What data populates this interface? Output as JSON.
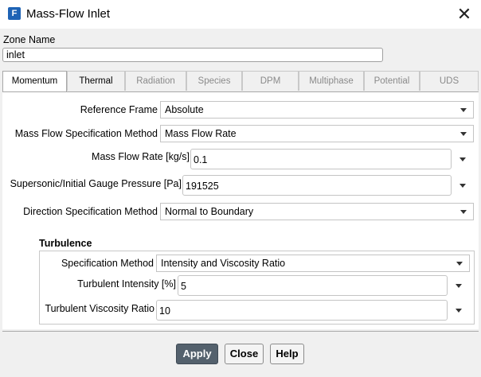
{
  "window": {
    "title": "Mass-Flow Inlet",
    "app_icon_letter": "F",
    "close_glyph": "✕"
  },
  "zone": {
    "label": "Zone Name",
    "value": "inlet"
  },
  "tabs": [
    "Momentum",
    "Thermal",
    "Radiation",
    "Species",
    "DPM",
    "Multiphase",
    "Potential",
    "UDS"
  ],
  "tabs_active": "Momentum",
  "momentum": {
    "reference_frame": {
      "label": "Reference Frame",
      "value": "Absolute"
    },
    "mass_flow_spec_method": {
      "label": "Mass Flow Specification Method",
      "value": "Mass Flow Rate"
    },
    "mass_flow_rate": {
      "label": "Mass Flow Rate [kg/s]",
      "value": "0.1"
    },
    "gauge_pressure": {
      "label": "Supersonic/Initial Gauge Pressure [Pa]",
      "value": "191525"
    },
    "direction_spec_method": {
      "label": "Direction Specification Method",
      "value": "Normal to Boundary"
    }
  },
  "turbulence": {
    "title": "Turbulence",
    "spec_method": {
      "label": "Specification Method",
      "value": "Intensity and Viscosity Ratio"
    },
    "intensity": {
      "label": "Turbulent Intensity [%]",
      "value": "5"
    },
    "viscosity_ratio": {
      "label": "Turbulent Viscosity Ratio",
      "value": "10"
    }
  },
  "buttons": {
    "apply": "Apply",
    "close": "Close",
    "help": "Help"
  },
  "colors": {
    "primary_button": "#54616d",
    "app_icon": "#1e63b5"
  }
}
